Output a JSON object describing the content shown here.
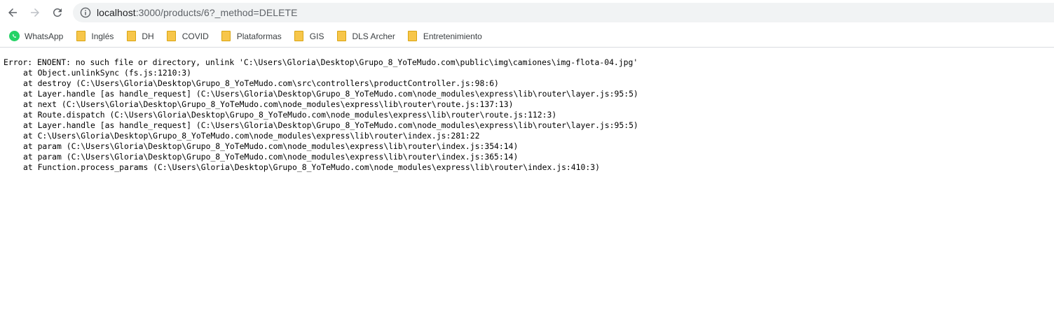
{
  "browser": {
    "url": "localhost:3000/products/6?_method=DELETE",
    "url_host": "localhost",
    "url_rest": ":3000/products/6?_method=DELETE",
    "icons": {
      "back": "back-arrow-icon",
      "forward": "forward-arrow-icon",
      "reload": "reload-icon",
      "info": "info-icon"
    }
  },
  "bookmarks": [
    {
      "label": "WhatsApp",
      "icon": "whatsapp-icon"
    },
    {
      "label": "Inglés",
      "icon": "folder-icon"
    },
    {
      "label": "DH",
      "icon": "folder-icon"
    },
    {
      "label": "COVID",
      "icon": "folder-icon"
    },
    {
      "label": "Plataformas",
      "icon": "folder-icon"
    },
    {
      "label": "GIS",
      "icon": "folder-icon"
    },
    {
      "label": "DLS Archer",
      "icon": "folder-icon"
    },
    {
      "label": "Entretenimiento",
      "icon": "folder-icon"
    }
  ],
  "error": {
    "message": "Error: ENOENT: no such file or directory, unlink 'C:\\Users\\Gloria\\Desktop\\Grupo_8_YoTeMudo.com\\public\\img\\camiones\\img-flota-04.jpg'",
    "stack": [
      "at Object.unlinkSync (fs.js:1210:3)",
      "at destroy (C:\\Users\\Gloria\\Desktop\\Grupo_8_YoTeMudo.com\\src\\controllers\\productController.js:98:6)",
      "at Layer.handle [as handle_request] (C:\\Users\\Gloria\\Desktop\\Grupo_8_YoTeMudo.com\\node_modules\\express\\lib\\router\\layer.js:95:5)",
      "at next (C:\\Users\\Gloria\\Desktop\\Grupo_8_YoTeMudo.com\\node_modules\\express\\lib\\router\\route.js:137:13)",
      "at Route.dispatch (C:\\Users\\Gloria\\Desktop\\Grupo_8_YoTeMudo.com\\node_modules\\express\\lib\\router\\route.js:112:3)",
      "at Layer.handle [as handle_request] (C:\\Users\\Gloria\\Desktop\\Grupo_8_YoTeMudo.com\\node_modules\\express\\lib\\router\\layer.js:95:5)",
      "at C:\\Users\\Gloria\\Desktop\\Grupo_8_YoTeMudo.com\\node_modules\\express\\lib\\router\\index.js:281:22",
      "at param (C:\\Users\\Gloria\\Desktop\\Grupo_8_YoTeMudo.com\\node_modules\\express\\lib\\router\\index.js:354:14)",
      "at param (C:\\Users\\Gloria\\Desktop\\Grupo_8_YoTeMudo.com\\node_modules\\express\\lib\\router\\index.js:365:14)",
      "at Function.process_params (C:\\Users\\Gloria\\Desktop\\Grupo_8_YoTeMudo.com\\node_modules\\express\\lib\\router\\index.js:410:3)"
    ]
  }
}
